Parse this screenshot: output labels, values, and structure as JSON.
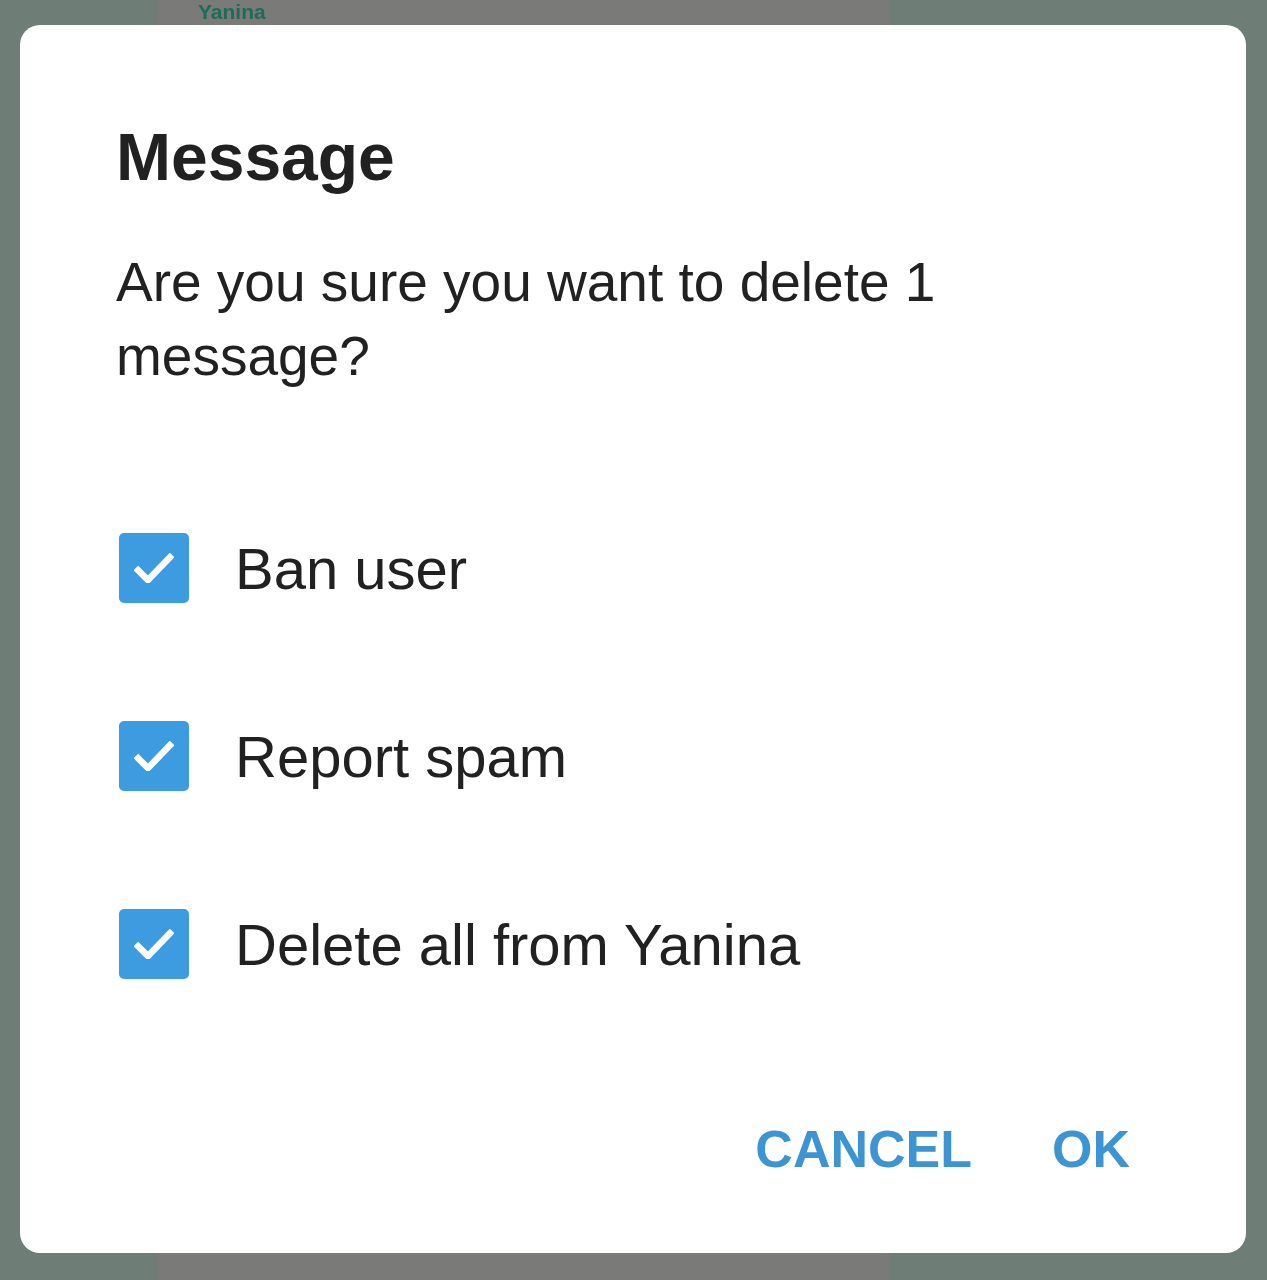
{
  "background": {
    "sender_name": "Yanina"
  },
  "dialog": {
    "title": "Message",
    "message": "Are you sure you want to delete 1 message?",
    "options": [
      {
        "label": "Ban user",
        "checked": true
      },
      {
        "label": "Report spam",
        "checked": true
      },
      {
        "label": "Delete all from Yanina",
        "checked": true
      }
    ],
    "buttons": [
      "CANCEL",
      "OK"
    ]
  }
}
